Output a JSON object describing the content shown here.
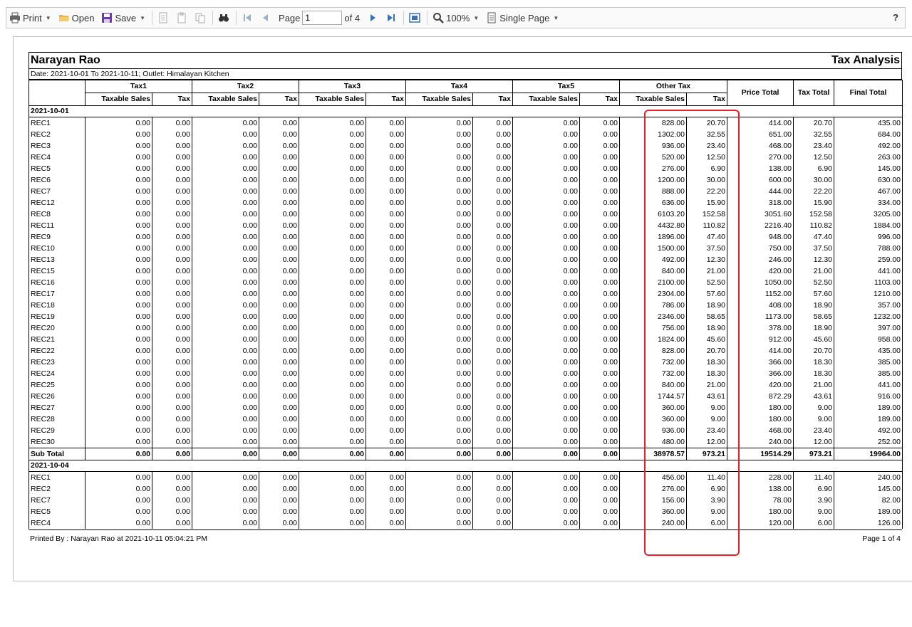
{
  "toolbar": {
    "print_label": "Print",
    "open_label": "Open",
    "save_label": "Save",
    "page_label": "Page",
    "page_value": "1",
    "page_of": "of 4",
    "zoom_label": "100%",
    "view_label": "Single Page",
    "help_label": "?"
  },
  "report": {
    "name": "Narayan Rao",
    "title": "Tax Analysis",
    "subtitle": "Date: 2021-10-01 To 2021-10-11; Outlet: Himalayan Kitchen",
    "tax_groups": [
      "Tax1",
      "Tax2",
      "Tax3",
      "Tax4",
      "Tax5",
      "Other Tax"
    ],
    "col_taxable": "Taxable Sales",
    "col_tax": "Tax",
    "col_price_total": "Price Total",
    "col_tax_total": "Tax Total",
    "col_final_total": "Final Total",
    "zero": "0.00",
    "sub_total_label": "Sub Total",
    "groups": [
      {
        "date": "2021-10-01",
        "rows": [
          [
            "REC1",
            "828.00",
            "20.70",
            "414.00",
            "20.70",
            "435.00"
          ],
          [
            "REC2",
            "1302.00",
            "32.55",
            "651.00",
            "32.55",
            "684.00"
          ],
          [
            "REC3",
            "936.00",
            "23.40",
            "468.00",
            "23.40",
            "492.00"
          ],
          [
            "REC4",
            "520.00",
            "12.50",
            "270.00",
            "12.50",
            "263.00"
          ],
          [
            "REC5",
            "276.00",
            "6.90",
            "138.00",
            "6.90",
            "145.00"
          ],
          [
            "REC6",
            "1200.00",
            "30.00",
            "600.00",
            "30.00",
            "630.00"
          ],
          [
            "REC7",
            "888.00",
            "22.20",
            "444.00",
            "22.20",
            "467.00"
          ],
          [
            "REC12",
            "636.00",
            "15.90",
            "318.00",
            "15.90",
            "334.00"
          ],
          [
            "REC8",
            "6103.20",
            "152.58",
            "3051.60",
            "152.58",
            "3205.00"
          ],
          [
            "REC11",
            "4432.80",
            "110.82",
            "2216.40",
            "110.82",
            "1884.00"
          ],
          [
            "REC9",
            "1896.00",
            "47.40",
            "948.00",
            "47.40",
            "996.00"
          ],
          [
            "REC10",
            "1500.00",
            "37.50",
            "750.00",
            "37.50",
            "788.00"
          ],
          [
            "REC13",
            "492.00",
            "12.30",
            "246.00",
            "12.30",
            "259.00"
          ],
          [
            "REC15",
            "840.00",
            "21.00",
            "420.00",
            "21.00",
            "441.00"
          ],
          [
            "REC16",
            "2100.00",
            "52.50",
            "1050.00",
            "52.50",
            "1103.00"
          ],
          [
            "REC17",
            "2304.00",
            "57.60",
            "1152.00",
            "57.60",
            "1210.00"
          ],
          [
            "REC18",
            "786.00",
            "18.90",
            "408.00",
            "18.90",
            "357.00"
          ],
          [
            "REC19",
            "2346.00",
            "58.65",
            "1173.00",
            "58.65",
            "1232.00"
          ],
          [
            "REC20",
            "756.00",
            "18.90",
            "378.00",
            "18.90",
            "397.00"
          ],
          [
            "REC21",
            "1824.00",
            "45.60",
            "912.00",
            "45.60",
            "958.00"
          ],
          [
            "REC22",
            "828.00",
            "20.70",
            "414.00",
            "20.70",
            "435.00"
          ],
          [
            "REC23",
            "732.00",
            "18.30",
            "366.00",
            "18.30",
            "385.00"
          ],
          [
            "REC24",
            "732.00",
            "18.30",
            "366.00",
            "18.30",
            "385.00"
          ],
          [
            "REC25",
            "840.00",
            "21.00",
            "420.00",
            "21.00",
            "441.00"
          ],
          [
            "REC26",
            "1744.57",
            "43.61",
            "872.29",
            "43.61",
            "916.00"
          ],
          [
            "REC27",
            "360.00",
            "9.00",
            "180.00",
            "9.00",
            "189.00"
          ],
          [
            "REC28",
            "360.00",
            "9.00",
            "180.00",
            "9.00",
            "189.00"
          ],
          [
            "REC29",
            "936.00",
            "23.40",
            "468.00",
            "23.40",
            "492.00"
          ],
          [
            "REC30",
            "480.00",
            "12.00",
            "240.00",
            "12.00",
            "252.00"
          ]
        ],
        "subtotal": [
          "38978.57",
          "973.21",
          "19514.29",
          "973.21",
          "19964.00"
        ]
      },
      {
        "date": "2021-10-04",
        "rows": [
          [
            "REC1",
            "456.00",
            "11.40",
            "228.00",
            "11.40",
            "240.00"
          ],
          [
            "REC2",
            "276.00",
            "6.90",
            "138.00",
            "6.90",
            "145.00"
          ],
          [
            "REC7",
            "156.00",
            "3.90",
            "78.00",
            "3.90",
            "82.00"
          ],
          [
            "REC5",
            "360.00",
            "9.00",
            "180.00",
            "9.00",
            "189.00"
          ],
          [
            "REC4",
            "240.00",
            "6.00",
            "120.00",
            "6.00",
            "126.00"
          ]
        ]
      }
    ],
    "printed_by": "Printed By : Narayan Rao at 2021-10-11 05:04:21 PM",
    "page_info": "Page 1 of 4"
  },
  "colors": {
    "highlight": "#e5202a",
    "save_icon": "#6b3fa0",
    "open_icon": "#e7b54a",
    "nav_icon": "#3a6fb0"
  }
}
